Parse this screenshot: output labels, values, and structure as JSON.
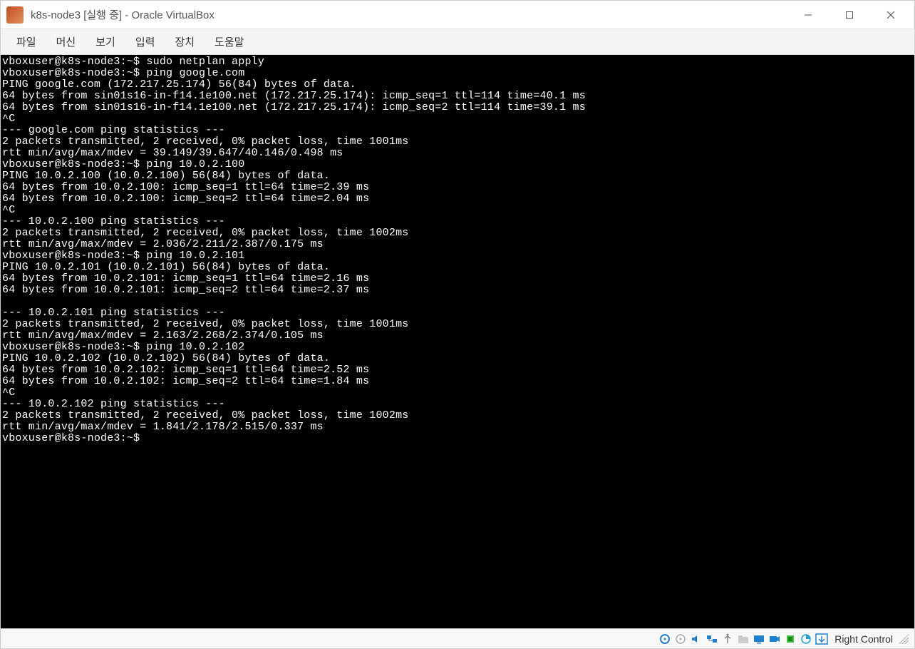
{
  "window": {
    "title": "k8s-node3 [실행 중] - Oracle VirtualBox"
  },
  "menu": {
    "items": [
      "파일",
      "머신",
      "보기",
      "입력",
      "장치",
      "도움말"
    ]
  },
  "terminal": {
    "lines": [
      "vboxuser@k8s-node3:~$ sudo netplan apply",
      "vboxuser@k8s-node3:~$ ping google.com",
      "PING google.com (172.217.25.174) 56(84) bytes of data.",
      "64 bytes from sin01s16-in-f14.1e100.net (172.217.25.174): icmp_seq=1 ttl=114 time=40.1 ms",
      "64 bytes from sin01s16-in-f14.1e100.net (172.217.25.174): icmp_seq=2 ttl=114 time=39.1 ms",
      "^C",
      "--- google.com ping statistics ---",
      "2 packets transmitted, 2 received, 0% packet loss, time 1001ms",
      "rtt min/avg/max/mdev = 39.149/39.647/40.146/0.498 ms",
      "vboxuser@k8s-node3:~$ ping 10.0.2.100",
      "PING 10.0.2.100 (10.0.2.100) 56(84) bytes of data.",
      "64 bytes from 10.0.2.100: icmp_seq=1 ttl=64 time=2.39 ms",
      "64 bytes from 10.0.2.100: icmp_seq=2 ttl=64 time=2.04 ms",
      "^C",
      "--- 10.0.2.100 ping statistics ---",
      "2 packets transmitted, 2 received, 0% packet loss, time 1002ms",
      "rtt min/avg/max/mdev = 2.036/2.211/2.387/0.175 ms",
      "vboxuser@k8s-node3:~$ ping 10.0.2.101",
      "PING 10.0.2.101 (10.0.2.101) 56(84) bytes of data.",
      "64 bytes from 10.0.2.101: icmp_seq=1 ttl=64 time=2.16 ms",
      "64 bytes from 10.0.2.101: icmp_seq=2 ttl=64 time=2.37 ms",
      "",
      "--- 10.0.2.101 ping statistics ---",
      "2 packets transmitted, 2 received, 0% packet loss, time 1001ms",
      "rtt min/avg/max/mdev = 2.163/2.268/2.374/0.105 ms",
      "vboxuser@k8s-node3:~$ ping 10.0.2.102",
      "PING 10.0.2.102 (10.0.2.102) 56(84) bytes of data.",
      "64 bytes from 10.0.2.102: icmp_seq=1 ttl=64 time=2.52 ms",
      "64 bytes from 10.0.2.102: icmp_seq=2 ttl=64 time=1.84 ms",
      "^C",
      "--- 10.0.2.102 ping statistics ---",
      "2 packets transmitted, 2 received, 0% packet loss, time 1002ms",
      "rtt min/avg/max/mdev = 1.841/2.178/2.515/0.337 ms",
      "vboxuser@k8s-node3:~$ "
    ]
  },
  "statusbar": {
    "host_key": "Right Control",
    "icons": [
      "harddisk-icon",
      "optical-icon",
      "audio-icon",
      "network-icon",
      "usb-icon",
      "shared-folder-icon",
      "display-icon",
      "recording-icon",
      "cpu-icon",
      "mouse-icon",
      "keyboard-icon"
    ]
  }
}
